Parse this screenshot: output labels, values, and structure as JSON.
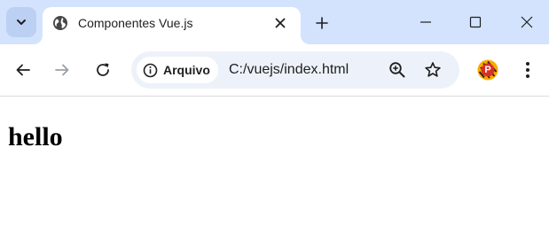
{
  "browser": {
    "tab": {
      "title": "Componentes Vue.js",
      "favicon": "globe-icon"
    },
    "address_bar": {
      "security_chip_label": "Arquivo",
      "url": "C:/vuejs/index.html"
    },
    "colors": {
      "tabstrip": "#d3e3fd",
      "omnibox": "#edf2fa",
      "profile_avatar": "#d93025"
    },
    "profile_initial": "P"
  },
  "page": {
    "heading": "hello"
  }
}
